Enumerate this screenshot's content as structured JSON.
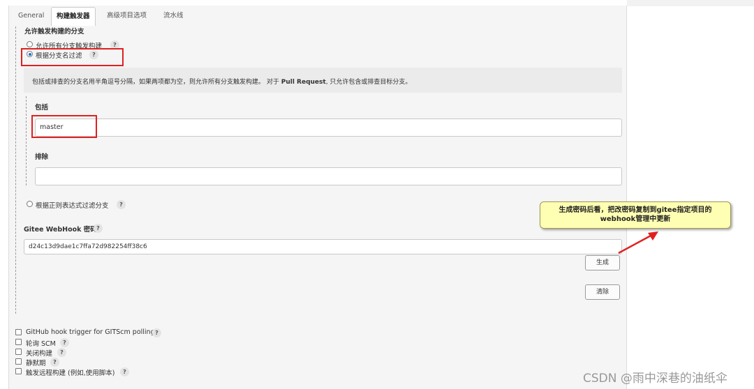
{
  "tabs": [
    "General",
    "构建触发器",
    "高级项目选项",
    "流水线"
  ],
  "section_title": "允许触发构建的分支",
  "branch_options": {
    "all_branches": "允许所有分支触发构建",
    "filter_by_name": "根据分支名过滤",
    "filter_by_regex": "根据正则表达式过滤分支"
  },
  "filter_description": {
    "part1": "包括或排查的分支名用半角逗号分隔，如果两项都为空，则允许所有分支触发构建。 对于 ",
    "bold": "Pull Request",
    "part2": ", 只允许包含或排查目标分支。"
  },
  "include": {
    "label": "包括",
    "value": "master"
  },
  "exclude": {
    "label": "排除",
    "value": ""
  },
  "webhook": {
    "label": "Gitee WebHook 密码",
    "value": "d24c13d9dae1c7ffa72d982254ff38c6"
  },
  "buttons": {
    "generate": "生成",
    "clear": "清除"
  },
  "help_glyph": "?",
  "triggers": [
    "GitHub hook trigger for GITScm polling",
    "轮询 SCM",
    "关闭构建",
    "静默期",
    "触发远程构建 (例如,使用脚本)"
  ],
  "callout": {
    "line1": "生成密码后看，把改密码复制到gitee指定项目的",
    "line2": "webhook管理中更新"
  },
  "watermark": "CSDN @雨中深巷的油纸伞",
  "colors": {
    "annotation_red": "#e02020",
    "callout_bg": "#ffffb3",
    "radio_selected": "#1e6fd0"
  }
}
